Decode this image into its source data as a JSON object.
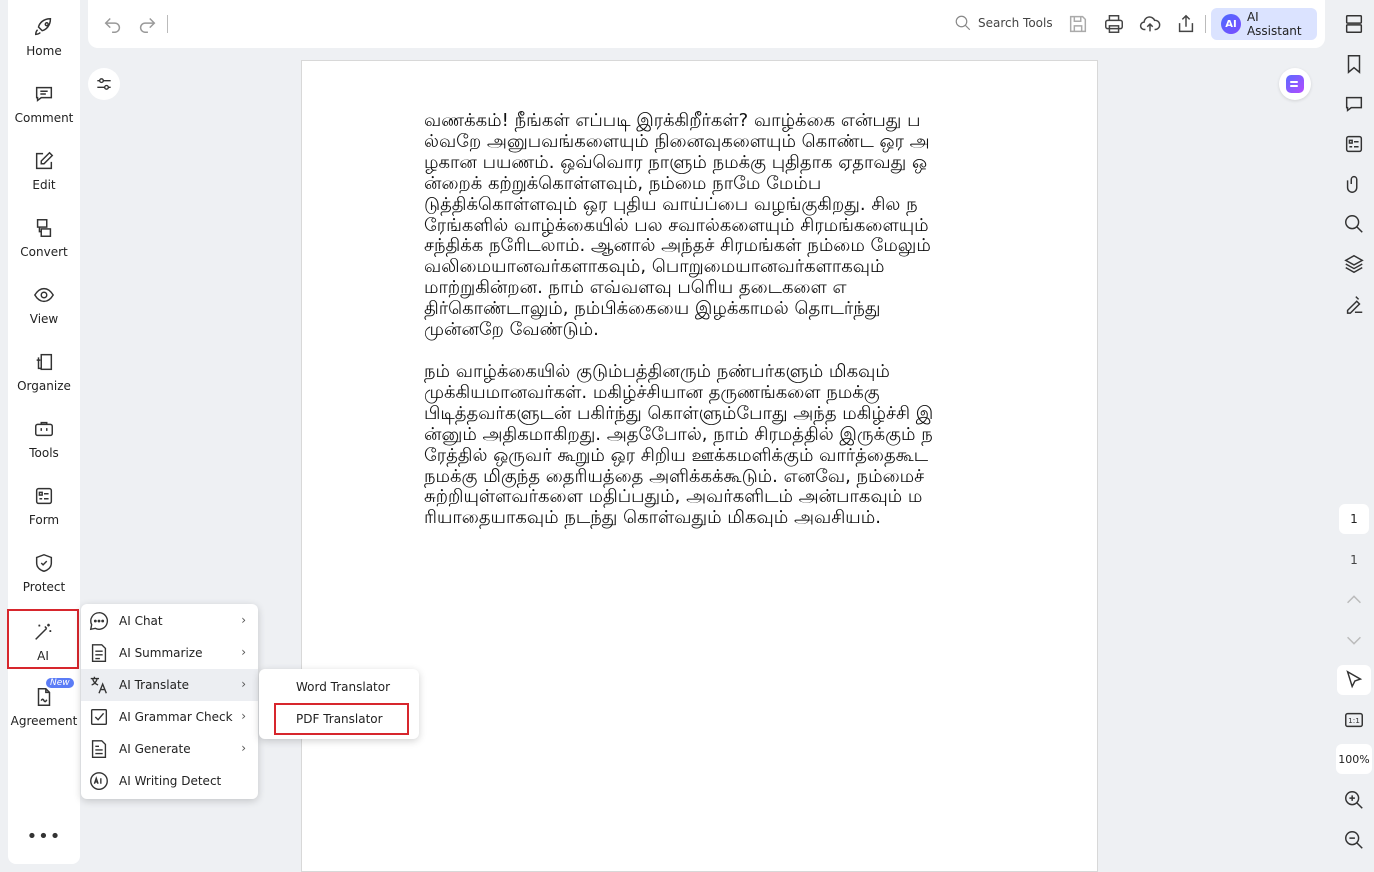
{
  "sidebar": {
    "items": [
      {
        "label": "Home",
        "icon": "rocket-icon"
      },
      {
        "label": "Comment",
        "icon": "comment-icon"
      },
      {
        "label": "Edit",
        "icon": "edit-icon"
      },
      {
        "label": "Convert",
        "icon": "convert-icon"
      },
      {
        "label": "View",
        "icon": "eye-icon"
      },
      {
        "label": "Organize",
        "icon": "organize-icon"
      },
      {
        "label": "Tools",
        "icon": "toolbox-icon"
      },
      {
        "label": "Form",
        "icon": "form-icon"
      },
      {
        "label": "Protect",
        "icon": "shield-icon"
      },
      {
        "label": "AI",
        "icon": "magic-wand-icon"
      },
      {
        "label": "Agreement",
        "icon": "agreement-icon",
        "badge": "New"
      }
    ],
    "more": "•••"
  },
  "toolbar": {
    "search_label": "Search Tools",
    "ai_assistant_label": "AI Assistant",
    "ai_logo_text": "AI"
  },
  "document": {
    "paragraphs": [
      "வணக்கம்! நீங்கள் எப்படி இரக்கிறீர்கள்? வாழ்க்கை என்பது பல்வறே அனுபவங்களையும் நினைவுகளையும் கொண்ட ஒர அழகான பயணம். ஒவ்வொர நாளும் நமக்கு புதிதாக ஏதாவது ஒன்றைக் கற்றுக்கொள்ளவும், நம்மை நாமே மேம்படுத்திக்கொள்ளவும் ஒர புதிய வாய்ப்பை வழங்குகிறது. சில நரேங்களில் வாழ்க்கையில் பல சவால்களையும் சிரமங்களையும் சந்திக்க நரேிடலாம். ஆனால் அந்தச் சிரமங்கள் நம்மை மேலும் வலிமையானவர்களாகவும், பொறுமையானவர்களாகவும் மாற்றுகின்றன. நாம் எவ்வளவு பரெிய தடைகளை எதிர்கொண்டாலும், நம்பிக்கையை இழக்காமல் தொடர்ந்து முன்னறே வேண்டும்.",
      "நம் வாழ்க்கையில் குடும்பத்தினரும் நண்பர்களும் மிகவும் முக்கியமானவர்கள். மகிழ்ச்சியான தருணங்களை நமக்கு பிடித்தவர்களுடன் பகிர்ந்து கொள்ளும்போது அந்த மகிழ்ச்சி இன்னும் அதிகமாகிறது. அதபேோல், நாம் சிரமத்தில் இருக்கும் நரேத்தில் ஒருவர் கூறும் ஒர சிறிய ஊக்கமளிக்கும் வார்த்தைகூட நமக்கு மிகுந்த தைரியத்தை அளிக்கக்கூடும். எனவே, நம்மைச் சுற்றியுள்ளவர்களை மதிப்பதும், அவர்களிடம் அன்பாகவும் மரியாதையாகவும் நடந்து கொள்வதும் மிகவும் அவசியம்."
    ]
  },
  "ai_menu": {
    "items": [
      {
        "label": "AI Chat",
        "icon": "ai-chat-icon",
        "has_submenu": true
      },
      {
        "label": "AI Summarize",
        "icon": "ai-summarize-icon",
        "has_submenu": true
      },
      {
        "label": "AI Translate",
        "icon": "ai-translate-icon",
        "has_submenu": true
      },
      {
        "label": "AI Grammar Check",
        "icon": "ai-grammar-check-icon",
        "has_submenu": true
      },
      {
        "label": "AI Generate",
        "icon": "ai-generate-icon",
        "has_submenu": true
      },
      {
        "label": "AI Writing Detect",
        "icon": "ai-writing-detect-icon",
        "has_submenu": false
      }
    ],
    "chevron": "›"
  },
  "translate_submenu": {
    "items": [
      {
        "label": "Word Translator"
      },
      {
        "label": "PDF Translator"
      }
    ]
  },
  "right_panel": {
    "current_page": "1",
    "total_pages": "1",
    "zoom": "100%",
    "fit_label": "1:1"
  },
  "colors": {
    "highlight_border": "#d7262d",
    "ai_assistant_bg": "#dbe3ff",
    "badge": "#5b7cf6"
  }
}
